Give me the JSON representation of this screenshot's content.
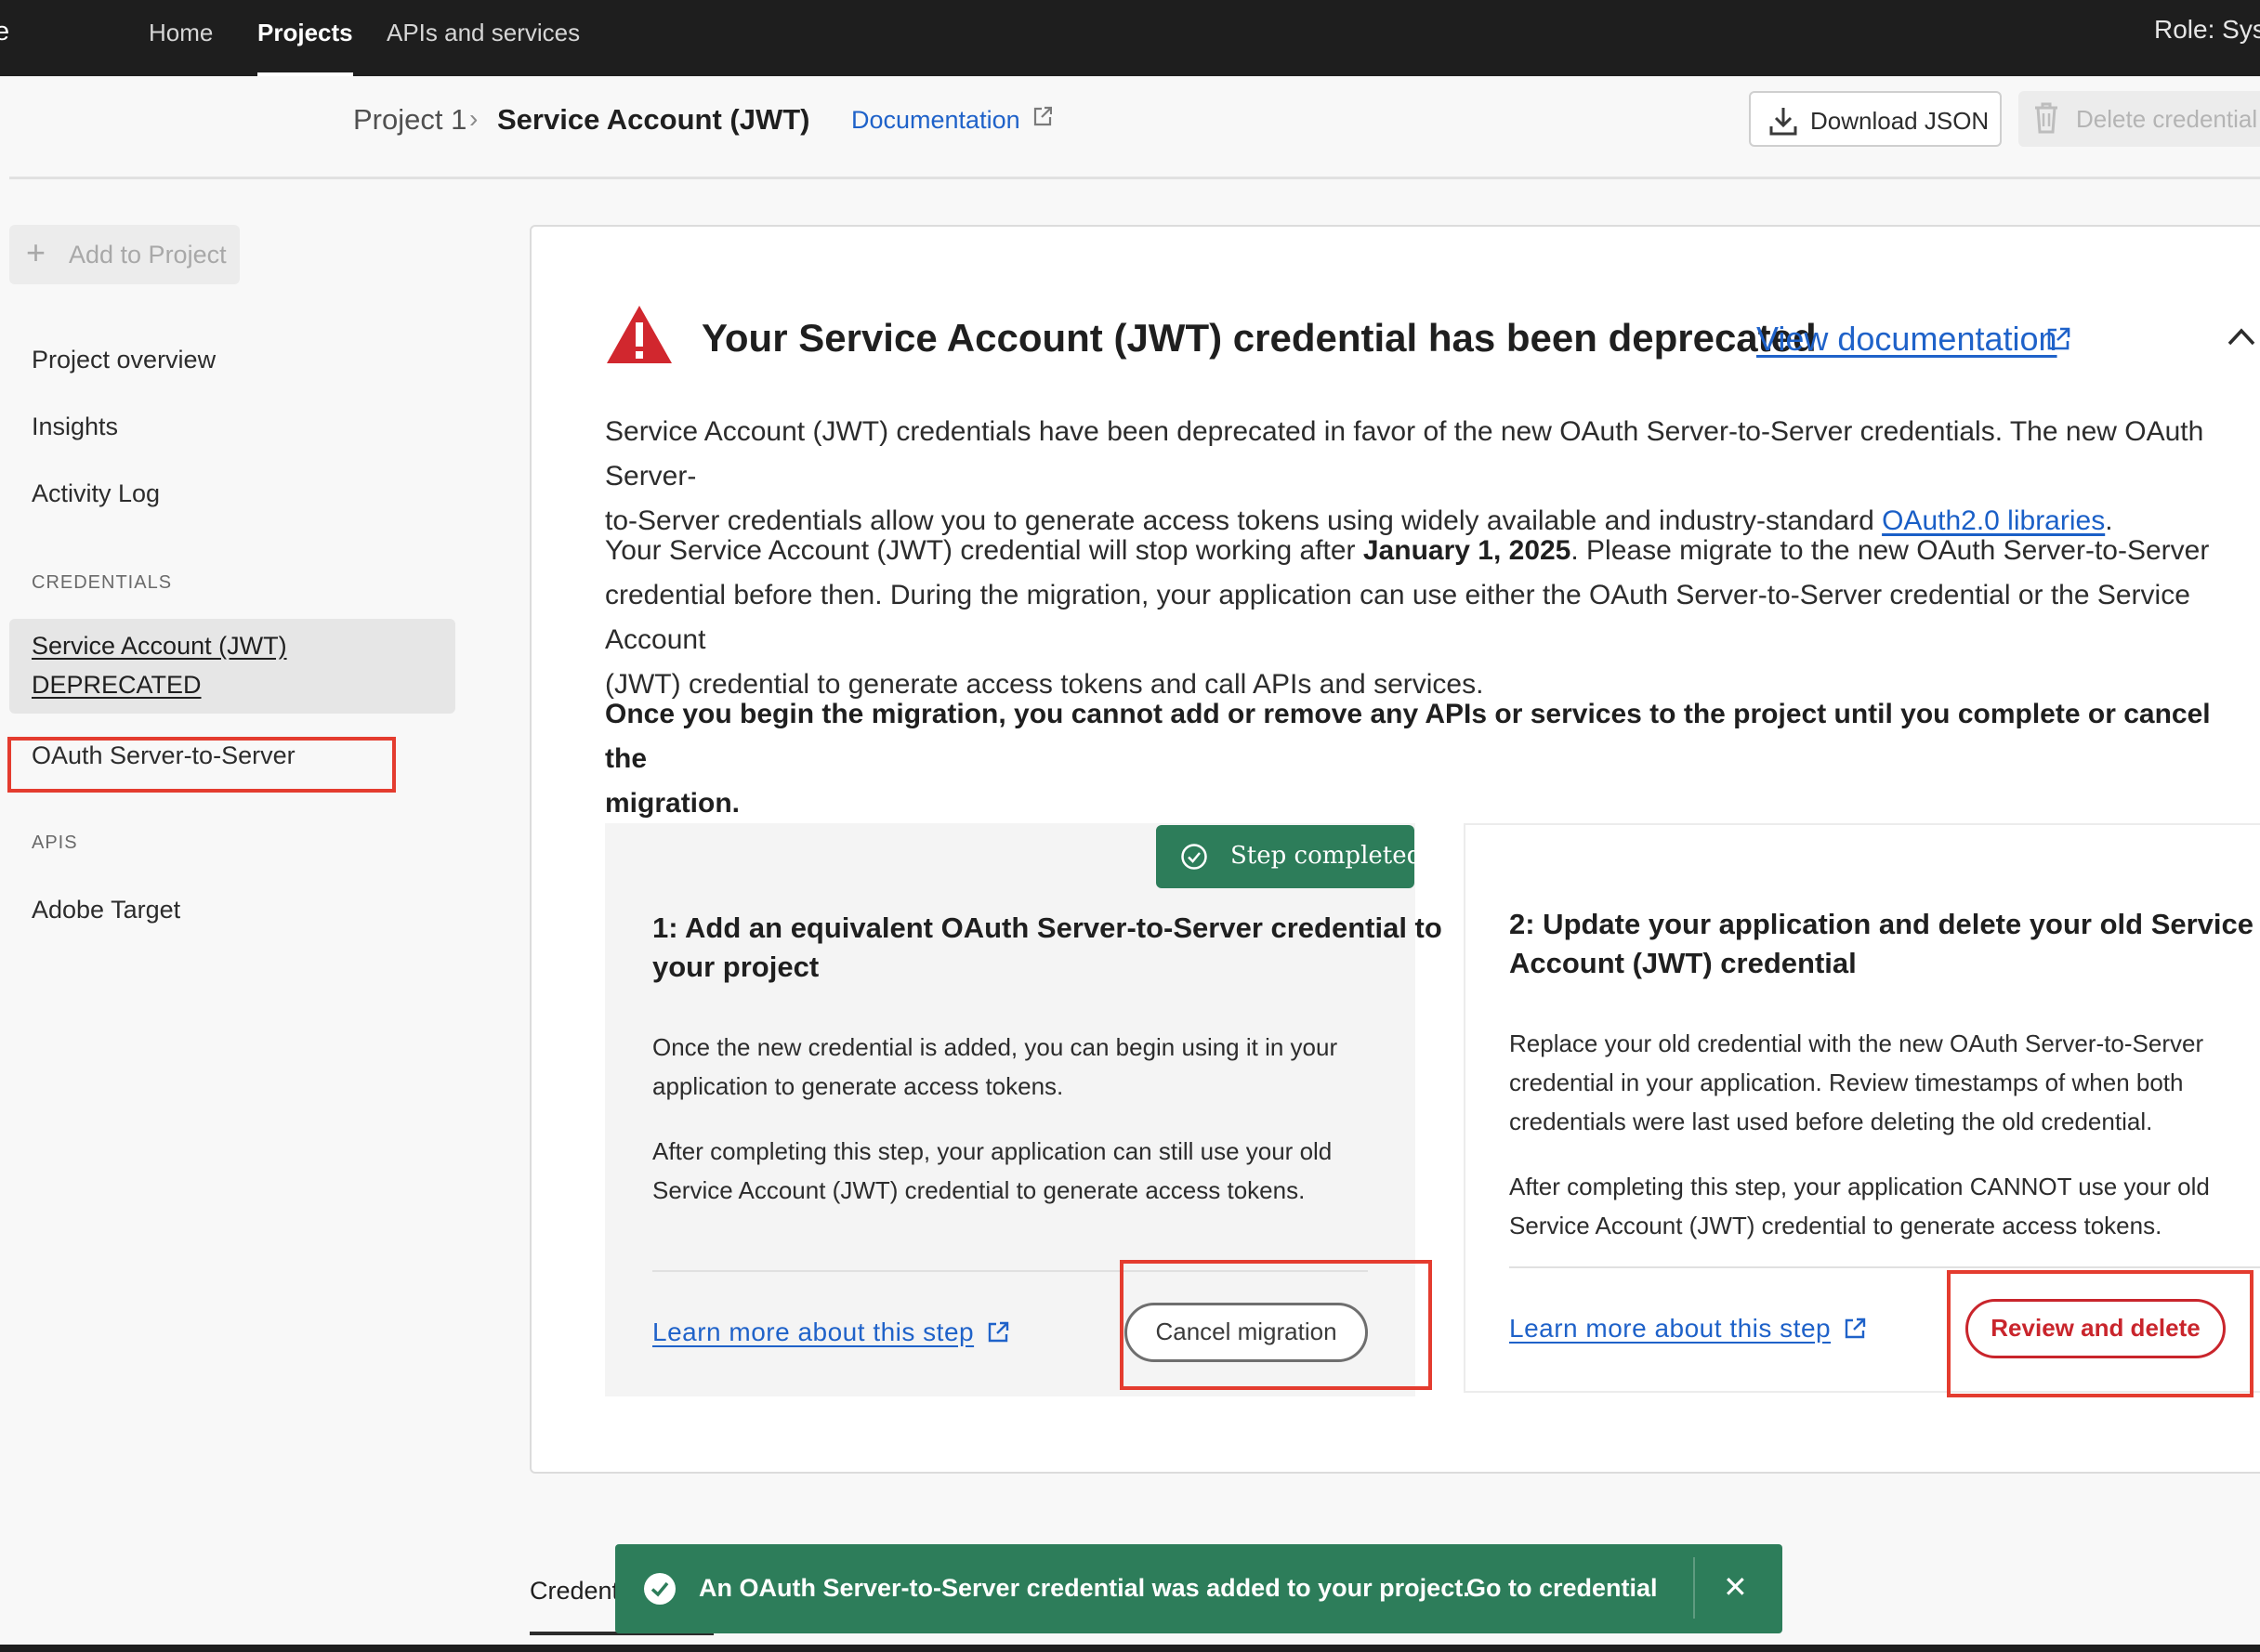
{
  "topnav": {
    "edge_glyph": "e",
    "tabs": [
      {
        "label": "Home",
        "active": false
      },
      {
        "label": "Projects",
        "active": true
      },
      {
        "label": "APIs and services",
        "active": false
      }
    ],
    "role": "Role: Sys"
  },
  "header": {
    "breadcrumb_project": "Project 1",
    "breadcrumb_current": "Service Account (JWT)",
    "documentation_link": "Documentation",
    "download_json": "Download JSON",
    "delete_credential": "Delete credential"
  },
  "sidebar": {
    "add_to_project": "Add to Project",
    "items": [
      "Project overview",
      "Insights",
      "Activity Log"
    ],
    "credentials_heading": "CREDENTIALS",
    "credentials": {
      "selected_line1": "Service Account (JWT)",
      "selected_line2": "DEPRECATED",
      "other": "OAuth Server-to-Server"
    },
    "apis_heading": "APIS",
    "apis": [
      "Adobe Target"
    ]
  },
  "alert": {
    "title": "Your Service Account (JWT) credential has been deprecated",
    "view_documentation": "View documentation",
    "p1_line1": "Service Account (JWT) credentials have been deprecated in favor of the new OAuth Server-to-Server credentials. The new OAuth Server-",
    "p1_line2": "to-Server credentials allow you to generate access tokens using widely available and industry-standard ",
    "p1_link": "OAuth2.0 libraries",
    "p1_end": ".",
    "p2_start": "Your Service Account (JWT) credential will stop working after ",
    "p2_date": "January 1, 2025",
    "p2_line1_rest": ". Please migrate to the new OAuth Server-to-Server",
    "p2_line2": "credential before then. During the migration, your application can use either the OAuth Server-to-Server credential or the Service Account",
    "p2_line3": "(JWT) credential to generate access tokens and call APIs and services.",
    "p3_line1": "Once you begin the migration, you cannot add or remove any APIs or services to the project until you complete or cancel the",
    "p3_line2": "migration."
  },
  "step1": {
    "badge": "Step completed",
    "title_line1": "1: Add an equivalent OAuth Server-to-Server credential to",
    "title_line2": "your project",
    "text1_line1": "Once the new credential is added, you can begin using it in your",
    "text1_line2": "application to generate access tokens.",
    "text2_line1": "After completing this step, your application can still use your old",
    "text2_line2": "Service Account (JWT) credential to generate access tokens.",
    "learn_more": "Learn more about this step",
    "button": "Cancel migration"
  },
  "step2": {
    "title_line1": "2: Update your application and delete your old Service",
    "title_line2": "Account (JWT) credential",
    "text1_line1": "Replace your old credential with the new OAuth Server-to-Server",
    "text1_line2": "credential in your application. Review timestamps of when both",
    "text1_line3": "credentials were last used before deleting the old credential.",
    "text2_line1": "After completing this step, your application CANNOT use your old",
    "text2_line2": "Service Account (JWT) credential to generate access tokens.",
    "learn_more": "Learn more about this step",
    "button": "Review and delete"
  },
  "bottom_tab": "Credent",
  "toast": {
    "message": "An OAuth Server-to-Server credential was added to your project.",
    "action": "Go to credential",
    "close": "✕"
  },
  "colors": {
    "topbar": "#1e1e1e",
    "success_green": "#2d7d5a",
    "danger_red": "#c9252c",
    "link_blue": "#1f62c9",
    "highlight_box": "#e43c2f",
    "warning_red": "#d1272e"
  }
}
